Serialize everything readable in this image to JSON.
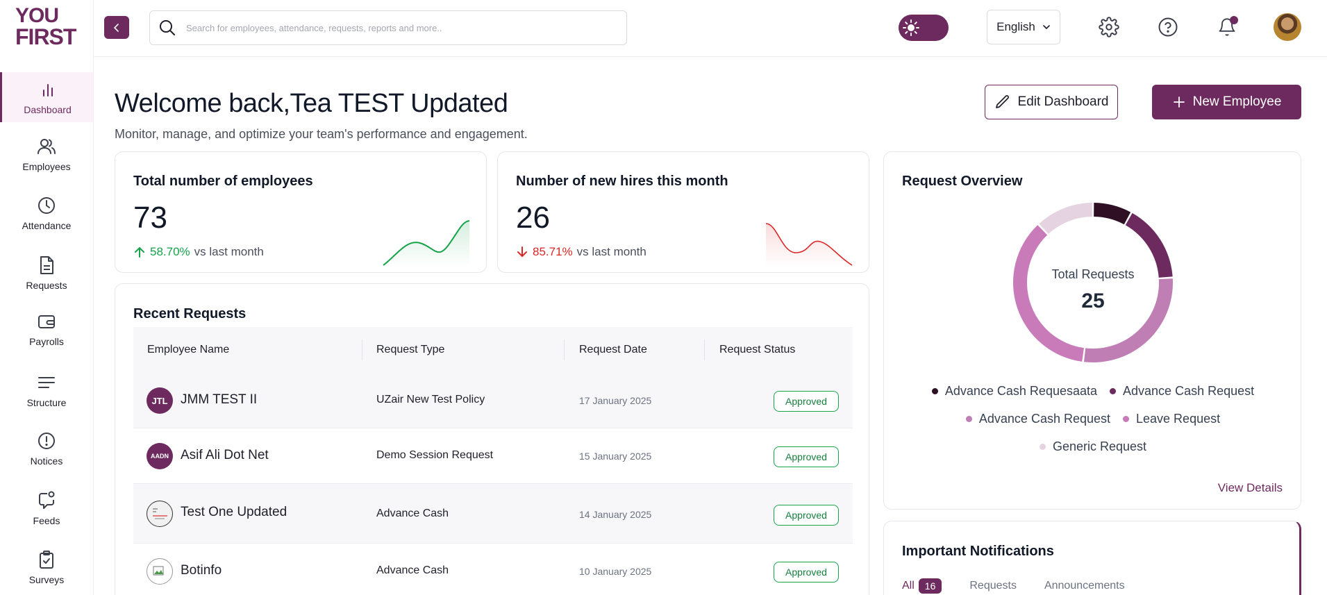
{
  "brand": {
    "logo_line1": "YOU",
    "logo_line2": "FIRST"
  },
  "colors": {
    "accent": "#6d2a5e",
    "positive": "#16a34a",
    "negative": "#dc2626"
  },
  "sidebar": {
    "items": [
      {
        "label": "Dashboard",
        "icon": "bar-chart-icon",
        "active": true
      },
      {
        "label": "Employees",
        "icon": "users-icon"
      },
      {
        "label": "Attendance",
        "icon": "clock-icon"
      },
      {
        "label": "Requests",
        "icon": "document-icon"
      },
      {
        "label": "Payrolls",
        "icon": "wallet-icon"
      },
      {
        "label": "Structure",
        "icon": "menu-lines-icon"
      },
      {
        "label": "Notices",
        "icon": "alert-circle-icon"
      },
      {
        "label": "Feeds",
        "icon": "chat-bubble-icon"
      },
      {
        "label": "Surveys",
        "icon": "clipboard-check-icon"
      }
    ]
  },
  "topbar": {
    "search_placeholder": "Search for employees, attendance, requests, reports and more..",
    "language": "English"
  },
  "header": {
    "welcome": "Welcome back,Tea TEST Updated",
    "subtitle": "Monitor, manage, and optimize your team's performance and engagement.",
    "edit_button": "Edit Dashboard",
    "new_button": "New Employee"
  },
  "stats": {
    "employees": {
      "title": "Total number of employees",
      "value": "73",
      "change": "58.70%",
      "suffix": "vs last month",
      "direction": "up"
    },
    "new_hires": {
      "title": "Number of new hires this month",
      "value": "26",
      "change": "85.71%",
      "suffix": "vs last month",
      "direction": "down"
    }
  },
  "recent_requests": {
    "title": "Recent Requests",
    "columns": [
      "Employee Name",
      "Request Type",
      "Request Date",
      "Request Status"
    ],
    "rows": [
      {
        "initials": "JTL",
        "name": "JMM TEST II",
        "type": "UZair New Test Policy",
        "date": "17 January 2025",
        "status": "Approved"
      },
      {
        "initials": "AADN",
        "name": "Asif Ali Dot Net",
        "type": "Demo Session Request",
        "date": "15 January 2025",
        "status": "Approved"
      },
      {
        "initials": "",
        "name": "Test One Updated",
        "type": "Advance Cash",
        "date": "14 January 2025",
        "status": "Approved"
      },
      {
        "initials": "",
        "name": "Botinfo",
        "type": "Advance Cash",
        "date": "10 January 2025",
        "status": "Approved"
      }
    ]
  },
  "request_overview": {
    "title": "Request Overview",
    "center_label": "Total Requests",
    "center_value": "25",
    "legend": [
      {
        "label": "Advance Cash Requesaata",
        "color": "#2e0f24"
      },
      {
        "label": "Advance Cash Request",
        "color": "#6d2a5e"
      },
      {
        "label": "Advance Cash Request",
        "color": "#c07fb4"
      },
      {
        "label": "Leave Request",
        "color": "#c97ab8"
      },
      {
        "label": "Generic Request",
        "color": "#e6d3e2"
      }
    ],
    "view_details": "View Details"
  },
  "chart_data": {
    "type": "pie",
    "slices": [
      {
        "label": "Advance Cash Requesaata",
        "value": 2
      },
      {
        "label": "Advance Cash Request",
        "value": 4
      },
      {
        "label": "Advance Cash Request",
        "value": 7
      },
      {
        "label": "Leave Request",
        "value": 9
      },
      {
        "label": "Generic Request",
        "value": 3
      }
    ]
  },
  "notifications": {
    "title": "Important Notifications",
    "tabs": {
      "all": "All",
      "all_count": "16",
      "requests": "Requests",
      "announcements": "Announcements"
    }
  }
}
